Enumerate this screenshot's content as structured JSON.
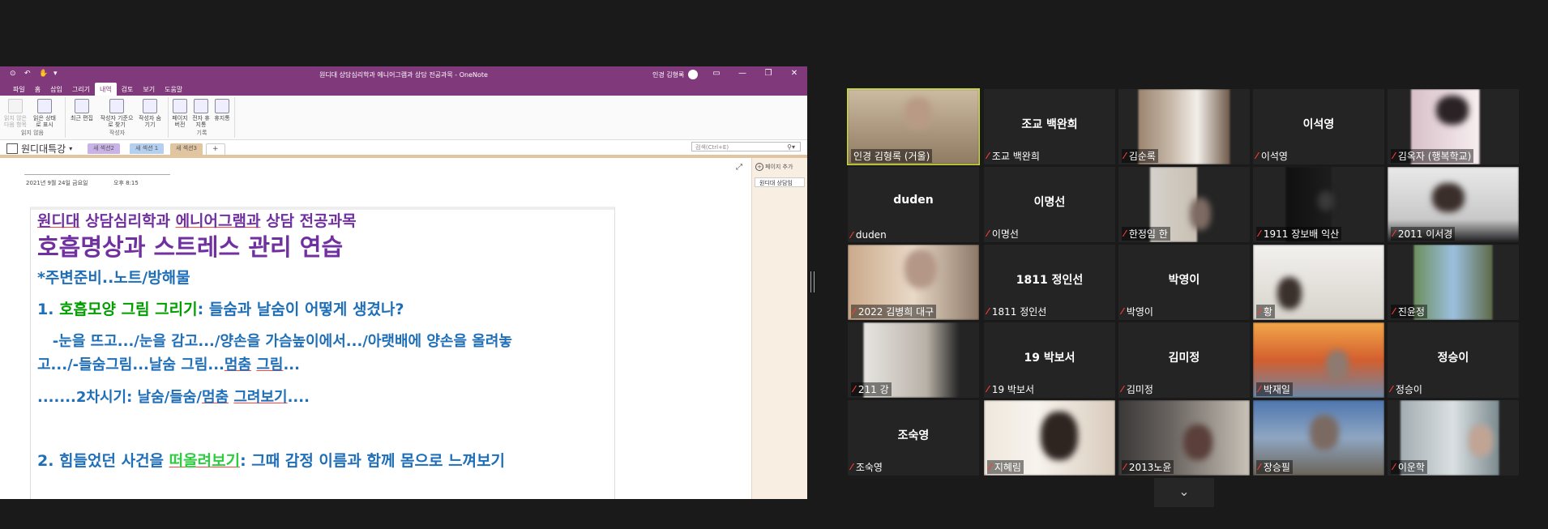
{
  "onenote": {
    "title": "원디대 상담심리학과 에니어그램과 상담 전공과목 - OneNote",
    "user": "인경 김형록",
    "ribbon_tabs": [
      "파일",
      "홈",
      "삽입",
      "그리기",
      "내역",
      "검토",
      "보기",
      "도움말"
    ],
    "active_tab": "내역",
    "ribbon_groups": [
      {
        "label": "읽지 않음",
        "buttons": [
          "읽지 않은 다음 항목",
          "읽은 상태로 표시"
        ]
      },
      {
        "label": "작성자",
        "buttons": [
          "최근 편집",
          "작성자 기준으로 찾기",
          "작성자 숨기기"
        ]
      },
      {
        "label": "기록",
        "buttons": [
          "페이지 버전",
          "전자 휴지통",
          "휴지통"
        ]
      }
    ],
    "notebook": "원디대특강",
    "sections": [
      "새 섹션2",
      "새 섹션 1",
      "새 섹션3"
    ],
    "search_placeholder": "검색(Ctrl+E)",
    "add_page": "페이지 추가",
    "page_list": [
      "원디대 상담임"
    ],
    "page_date": "2021년 9월 24일 금요일",
    "page_time": "오후 8:15",
    "content": {
      "line1": {
        "a": "원디대",
        "b": " 상담심리학과 ",
        "c": "에니어그램과",
        "d": " 상담 전공과목"
      },
      "line2": "호흡명상과 스트레스 관리 연습",
      "line3": "*주변준비..노트/방해물",
      "line4": {
        "a": "1. ",
        "b": "호흡모양 그림 그리기",
        "c": ": 들숨과 날숨이 어떻게 생겼나?"
      },
      "line5": "   -눈을 뜨고.../눈을 감고.../양손을 가슴높이에서.../아랫배에 양손을 올려놓",
      "line6": {
        "a": "고.../-들숨그림...날숨 그림...",
        "b": "멈춤",
        "c": " ",
        "d": "그림",
        "e": "..."
      },
      "line7": {
        "a": ".......2차시기: 날숨/들숨/",
        "b": "멈춤",
        "c": " ",
        "d": "그려보기",
        "e": "...."
      },
      "line8": {
        "a": "2. 힘들었던 사건을 ",
        "b": "떠올려보기",
        "c": ": 그때 감정 이름과 함께 몸으로 느껴보기"
      }
    }
  },
  "gallery": [
    {
      "label": "인경 김형록 (거울)",
      "muted": false,
      "active": true,
      "video": true
    },
    {
      "name": "조교 백완희",
      "label": "조교 백완희",
      "muted": true,
      "video": false
    },
    {
      "label": "김순록",
      "muted": true,
      "video": true
    },
    {
      "name": "이석영",
      "label": "이석영",
      "muted": true,
      "video": false
    },
    {
      "label": "김옥자 (행복학교)",
      "muted": true,
      "video": true
    },
    {
      "name": "duden",
      "label": "duden",
      "muted": true,
      "video": false
    },
    {
      "name": "이명선",
      "label": "이명선",
      "muted": true,
      "video": false
    },
    {
      "label": "한정임 한",
      "muted": true,
      "video": true
    },
    {
      "label": "1911 장보배 익산",
      "muted": true,
      "video": true
    },
    {
      "label": "2011 이서경",
      "muted": true,
      "video": true
    },
    {
      "label": "2022 김병희 대구",
      "muted": true,
      "video": true
    },
    {
      "name": "1811 정인선",
      "label": "1811 정인선",
      "muted": true,
      "video": false
    },
    {
      "name": "박영이",
      "label": "박영이",
      "muted": true,
      "video": false
    },
    {
      "label": "황",
      "muted": true,
      "video": true
    },
    {
      "label": "진윤정",
      "muted": true,
      "video": true
    },
    {
      "label": "211 강",
      "muted": true,
      "video": true
    },
    {
      "name": "19 박보서",
      "label": "19 박보서",
      "muted": true,
      "video": false
    },
    {
      "name": "김미정",
      "label": "김미정",
      "muted": true,
      "video": false
    },
    {
      "label": "박재일",
      "muted": true,
      "video": true
    },
    {
      "name": "정승이",
      "label": "정승이",
      "muted": true,
      "video": false
    },
    {
      "name": "조숙영",
      "label": "조숙영",
      "muted": true,
      "video": false
    },
    {
      "label": "지혜림",
      "muted": true,
      "video": true
    },
    {
      "label": "2013노윤",
      "muted": true,
      "video": true
    },
    {
      "label": "장승필",
      "muted": true,
      "video": true
    },
    {
      "label": "이운학",
      "muted": true,
      "video": true
    }
  ],
  "icons": {
    "mic_muted": "mic-muted-icon",
    "scroll": "chevron-down-icon"
  },
  "colors": {
    "onenote_purple": "#80397b",
    "active_speaker": "#c5e01e",
    "muted_red": "#ff3b30"
  }
}
